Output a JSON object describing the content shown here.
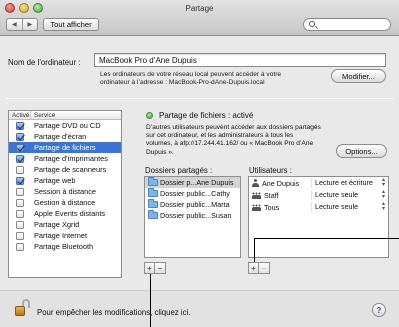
{
  "window": {
    "title": "Partage"
  },
  "toolbar": {
    "back_glyph": "◀",
    "forward_glyph": "▶",
    "show_all_label": "Tout afficher",
    "search_value": ""
  },
  "computer": {
    "name_label": "Nom de l’ordinateur :",
    "name_value": "MacBook Pro d’Ane Dupuis",
    "note": "Les ordinateurs de votre réseau local peuvent accéder à votre ordinateur à l’adresse : MacBook-Pro-dAne-Dupuis.local",
    "modify_button": "Modifier..."
  },
  "services": {
    "header_active": "Activé",
    "header_service": "Service",
    "items": [
      {
        "label": "Partage DVD ou CD",
        "checked": true,
        "selected": false
      },
      {
        "label": "Partage d’écran",
        "checked": true,
        "selected": false
      },
      {
        "label": "Partage de fichiers",
        "checked": true,
        "selected": true
      },
      {
        "label": "Partage d’imprimantes",
        "checked": true,
        "selected": false
      },
      {
        "label": "Partage de scanneurs",
        "checked": false,
        "selected": false
      },
      {
        "label": "Partage web",
        "checked": true,
        "selected": false
      },
      {
        "label": "Session à distance",
        "checked": false,
        "selected": false
      },
      {
        "label": "Gestion à distance",
        "checked": false,
        "selected": false
      },
      {
        "label": "Apple Events distants",
        "checked": false,
        "selected": false
      },
      {
        "label": "Partage Xgrid",
        "checked": false,
        "selected": false
      },
      {
        "label": "Partage Internet",
        "checked": false,
        "selected": false
      },
      {
        "label": "Partage Bluetooth",
        "checked": false,
        "selected": false
      }
    ]
  },
  "file_sharing": {
    "status": "Partage de fichiers : activé",
    "status_color": "#3a9b25",
    "description": "D’autres utilisateurs peuvent accéder aux dossiers partagés sur cet ordinateur, et les administrateurs à tous les volumes, à afp://17.244.41.162/ ou « MacBook Pro d’Ane Dupuis ».",
    "options_button": "Options...",
    "shared_folders_title": "Dossiers partagés :",
    "users_title": "Utilisateurs :",
    "folders": [
      {
        "label": "Dossier p...Ane Dupuis",
        "selected": true
      },
      {
        "label": "Dossier public...Cathy",
        "selected": false
      },
      {
        "label": "Dossier public...Marta",
        "selected": false
      },
      {
        "label": "Dossier public...Susan",
        "selected": false
      }
    ],
    "users": [
      {
        "name": "Ane Dupuis",
        "icon": "user-icon",
        "permission": "Lecture et écriture"
      },
      {
        "name": "Staff",
        "icon": "group-icon",
        "permission": "Lecture seule"
      },
      {
        "name": "Tous",
        "icon": "group-icon",
        "permission": "Lecture seule"
      }
    ],
    "add_label": "+",
    "remove_label": "−"
  },
  "footer": {
    "lock_text": "Pour empêcher les modifications, cliquez ici.",
    "help_label": "?"
  },
  "colors": {
    "selection": "#3875d7",
    "accent": "#5f95d7"
  }
}
